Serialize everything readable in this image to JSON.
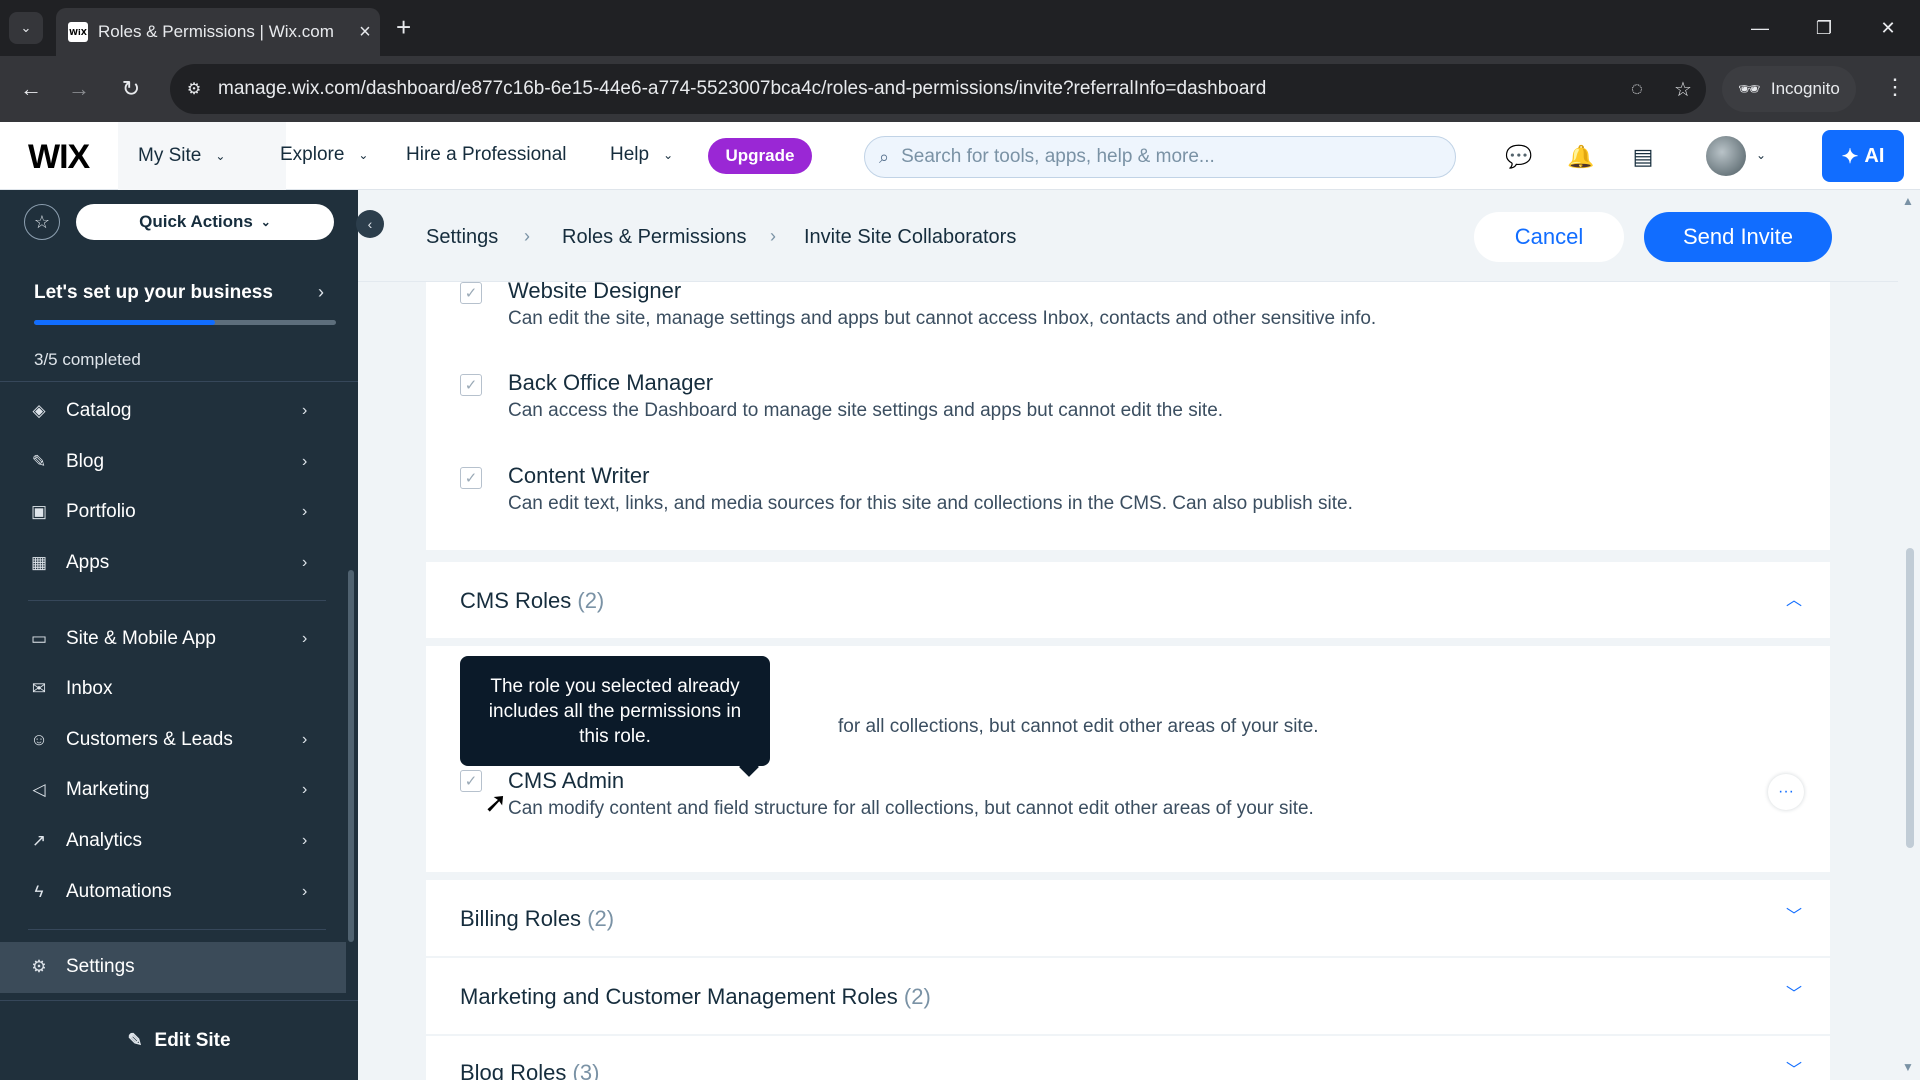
{
  "browser": {
    "tab_title": "Roles & Permissions | Wix.com",
    "favicon_text": "WiX",
    "url": "manage.wix.com/dashboard/e877c16b-6e15-44e6-a774-5523007bca4c/roles-and-permissions/invite?referralInfo=dashboard",
    "incognito_label": "Incognito"
  },
  "topbar": {
    "logo": "WIX",
    "my_site": "My Site",
    "explore": "Explore",
    "hire": "Hire a Professional",
    "help": "Help",
    "upgrade": "Upgrade",
    "search_placeholder": "Search for tools, apps, help & more...",
    "ai_label": "AI"
  },
  "sidebar": {
    "quick_actions": "Quick Actions",
    "setup_title": "Let's set up your business",
    "setup_count": "3/5 completed",
    "setup_progress": 0.6,
    "items": [
      {
        "label": "Catalog",
        "icon": "catalog-icon"
      },
      {
        "label": "Blog",
        "icon": "blog-icon"
      },
      {
        "label": "Portfolio",
        "icon": "portfolio-icon"
      },
      {
        "label": "Apps",
        "icon": "apps-icon"
      },
      {
        "label": "Site & Mobile App",
        "icon": "site-mobile-icon"
      },
      {
        "label": "Inbox",
        "icon": "inbox-icon"
      },
      {
        "label": "Customers & Leads",
        "icon": "customers-icon"
      },
      {
        "label": "Marketing",
        "icon": "marketing-icon"
      },
      {
        "label": "Analytics",
        "icon": "analytics-icon"
      },
      {
        "label": "Automations",
        "icon": "automations-icon"
      },
      {
        "label": "Settings",
        "icon": "settings-icon"
      }
    ],
    "edit_site": "Edit Site"
  },
  "header": {
    "breadcrumb": [
      "Settings",
      "Roles & Permissions",
      "Invite Site Collaborators"
    ],
    "cancel": "Cancel",
    "send_invite": "Send Invite"
  },
  "roles_top": [
    {
      "title": "Website Designer",
      "desc": "Can edit the site, manage settings and apps but cannot access Inbox, contacts and other sensitive info."
    },
    {
      "title": "Back Office Manager",
      "desc": "Can access the Dashboard to manage site settings and apps but cannot edit the site."
    },
    {
      "title": "Content Writer",
      "desc": "Can edit text, links, and media sources for this site and collections in the CMS. Can also publish site."
    }
  ],
  "cms_section": {
    "title": "CMS Roles",
    "count": "(2)",
    "partial_desc": "for all collections, but cannot edit other areas of your site.",
    "tooltip": "The role you selected already includes all the permissions in this role.",
    "admin_title": "CMS Admin",
    "admin_desc": "Can modify content and field structure for all collections, but cannot edit other areas of your site."
  },
  "sections": [
    {
      "title": "Billing Roles",
      "count": "(2)"
    },
    {
      "title": "Marketing and Customer Management Roles",
      "count": "(2)"
    },
    {
      "title": "Blog Roles",
      "count": "(3)"
    }
  ],
  "colors": {
    "accent": "#116dff",
    "upgrade": "#9a27d5",
    "sidebar": "#20303c",
    "tooltip": "#0b1a29"
  }
}
